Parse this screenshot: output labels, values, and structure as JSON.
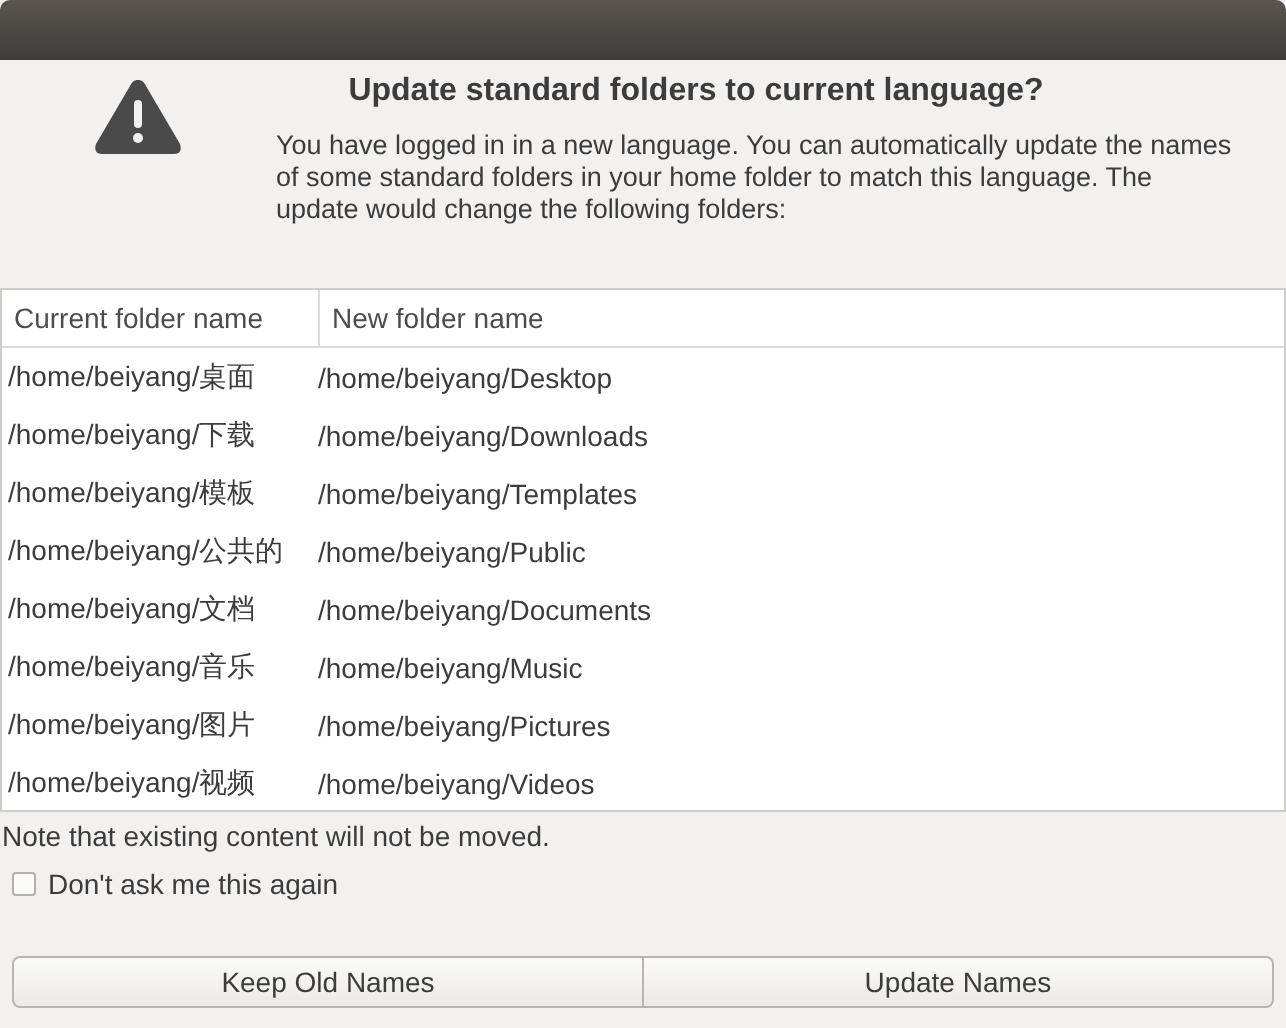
{
  "dialog": {
    "title": "Update standard folders to current language?",
    "message": "You have logged in in a new language. You can automatically update the names of some standard folders in your home folder to match this language. The update would change the following folders:"
  },
  "table": {
    "columns": [
      "Current folder name",
      "New folder name"
    ],
    "rows": [
      [
        "/home/beiyang/桌面",
        "/home/beiyang/Desktop"
      ],
      [
        "/home/beiyang/下载",
        "/home/beiyang/Downloads"
      ],
      [
        "/home/beiyang/模板",
        "/home/beiyang/Templates"
      ],
      [
        "/home/beiyang/公共的",
        "/home/beiyang/Public"
      ],
      [
        "/home/beiyang/文档",
        "/home/beiyang/Documents"
      ],
      [
        "/home/beiyang/音乐",
        "/home/beiyang/Music"
      ],
      [
        "/home/beiyang/图片",
        "/home/beiyang/Pictures"
      ],
      [
        "/home/beiyang/视频",
        "/home/beiyang/Videos"
      ]
    ]
  },
  "note": "Note that existing content will not be moved.",
  "dont_ask": {
    "label": "Don't ask me this again",
    "checked": false
  },
  "buttons": [
    "Keep Old Names",
    "Update Names"
  ]
}
